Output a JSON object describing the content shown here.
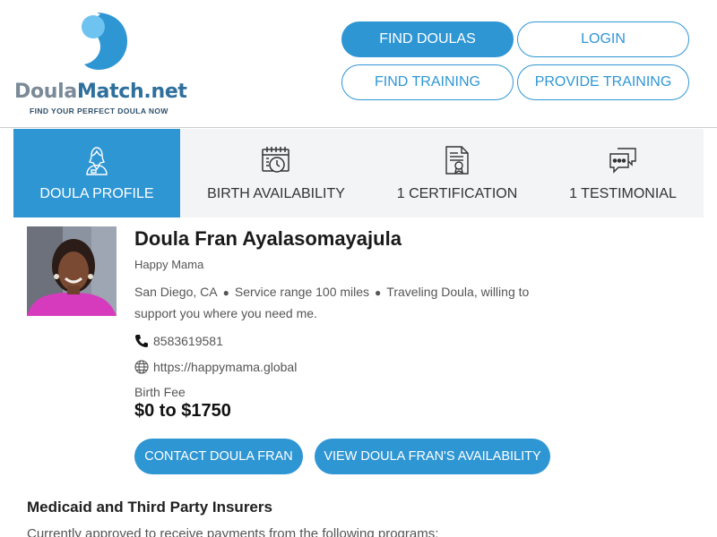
{
  "logo": {
    "word_part1": "Doula",
    "word_part2": "Match.net",
    "tagline": "FIND YOUR PERFECT DOULA NOW"
  },
  "nav": {
    "find_doulas": "FIND DOULAS",
    "login": "LOGIN",
    "find_training": "FIND TRAINING",
    "provide_training": "PROVIDE TRAINING"
  },
  "tabs": [
    {
      "label": "DOULA PROFILE",
      "icon": "user-profile-icon",
      "active": true
    },
    {
      "label": "BIRTH AVAILABILITY",
      "icon": "calendar-clock-icon",
      "active": false
    },
    {
      "label": "1 CERTIFICATION",
      "icon": "certificate-icon",
      "active": false
    },
    {
      "label": "1 TESTIMONIAL",
      "icon": "chat-bubbles-icon",
      "active": false
    }
  ],
  "profile": {
    "name": "Doula Fran Ayalasomayajula",
    "business": "Happy Mama",
    "city": "San Diego, CA",
    "service_range": "Service range 100 miles",
    "traveling": "Traveling Doula, willing to support you where you need me.",
    "phone": "8583619581",
    "website": "https://happymama.global",
    "fee_label": "Birth Fee",
    "fee_value": "$0 to $1750"
  },
  "actions": {
    "contact": "CONTACT DOULA FRAN",
    "availability": "VIEW DOULA FRAN'S AVAILABILITY"
  },
  "insurers": {
    "title": "Medicaid and Third Party Insurers",
    "text": "Currently approved to receive payments from the following programs:"
  },
  "colors": {
    "accent": "#2f96d4",
    "tab_bg": "#f3f4f5",
    "text_muted": "#555555"
  }
}
